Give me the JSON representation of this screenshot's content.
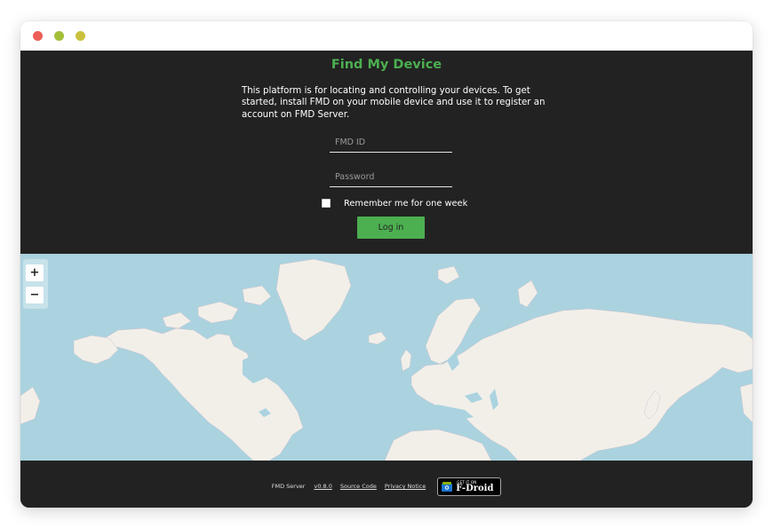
{
  "window": {
    "controls": {
      "close_color": "#ec5f57",
      "minimize_color": "#a3bf3a",
      "maximize_color": "#c9c13c"
    }
  },
  "colors": {
    "accent": "#4caf50",
    "background": "#222222",
    "map_water": "#aad3df",
    "map_land": "#f2efe9"
  },
  "login": {
    "title": "Find My Device",
    "intro": "This platform is for locating and controlling your devices. To get started, install FMD on your mobile device and use it to register an account on FMD Server.",
    "fmd_id_placeholder": "FMD ID",
    "fmd_id_value": "",
    "password_placeholder": "Password",
    "password_value": "",
    "remember_label": "Remember me for one week",
    "remember_checked": false,
    "login_button": "Log in"
  },
  "map": {
    "zoom_in_label": "+",
    "zoom_out_label": "−"
  },
  "footer": {
    "app_name": "FMD Server",
    "version_link": "v0.8.0",
    "source_link": "Source Code",
    "privacy_link": "Privacy Notice",
    "badge_small_text": "GET IT ON",
    "badge_big_text": "F-Droid"
  }
}
